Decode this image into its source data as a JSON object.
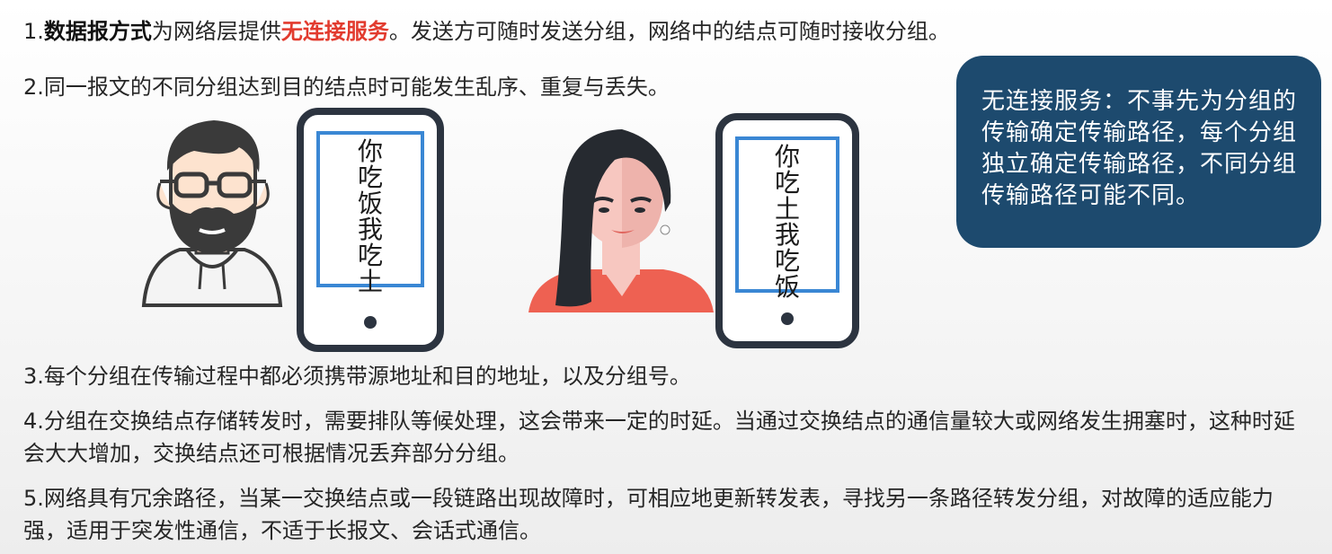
{
  "points": {
    "p1": {
      "prefix": "1.",
      "bold_term": "数据报方式",
      "mid": "为网络层提供",
      "highlight": "无连接服务",
      "rest": "。发送方可随时发送分组，网络中的结点可随时接收分组。"
    },
    "p2": "2.同一报文的不同分组达到目的结点时可能发生乱序、重复与丢失。",
    "p3": "3.每个分组在传输过程中都必须携带源地址和目的地址，以及分组号。",
    "p4": "4.分组在交换结点存储转发时，需要排队等候处理，这会带来一定的时延。当通过交换结点的通信量较大或网络发生拥塞时，这种时延会大大增加，交换结点还可根据情况丢弃部分分组。",
    "p5": "5.网络具有冗余路径，当某一交换结点或一段链路出现故障时，可相应地更新转发表，寻找另一条路径转发分组，对故障的适应能力强，适用于突发性通信，不适于长报文、会话式通信。"
  },
  "note": {
    "text": "无连接服务：不事先为分组的传输确定传输路径，每个分组独立确定传输路径，不同分组传输路径可能不同。",
    "bg_color": "#1d4a6e"
  },
  "illustration": {
    "phone1_text": "你吃饭我吃土",
    "phone2_text": "你吃土我吃饭",
    "man_icon": "bearded-man-icon",
    "woman_icon": "woman-icon",
    "accent_blue": "#3a87d4",
    "accent_red": "#e23b2e"
  }
}
